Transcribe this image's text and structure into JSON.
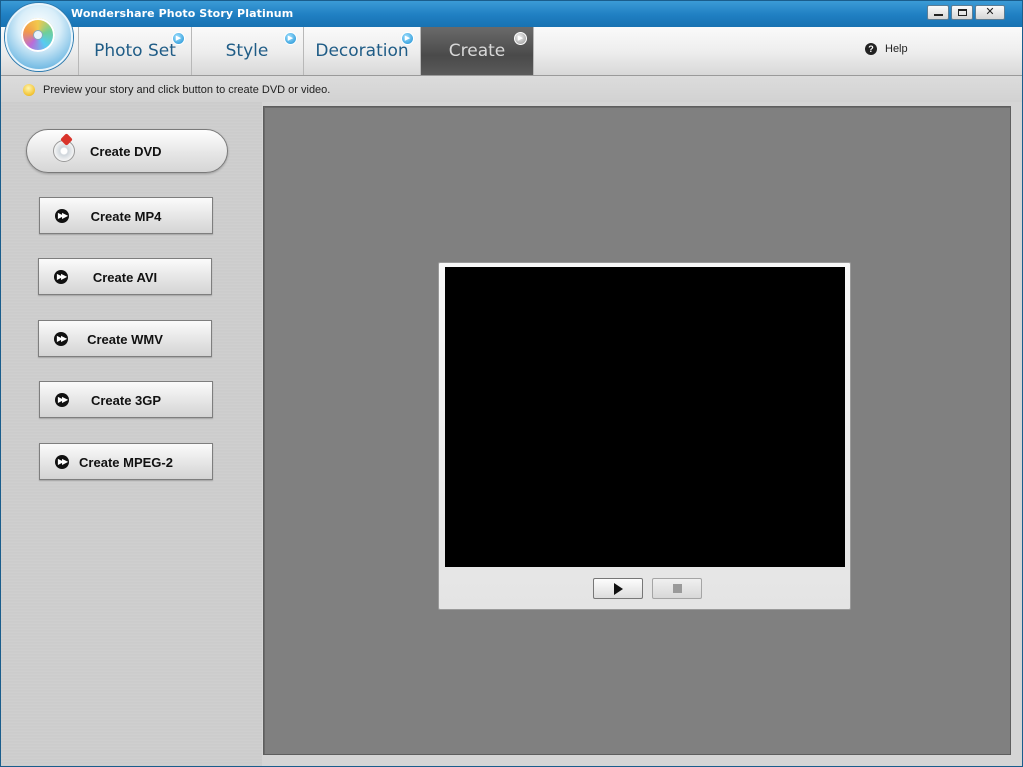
{
  "window": {
    "title": "Wondershare Photo Story Platinum",
    "controls": {
      "minimize": "minimize-icon",
      "maximize": "maximize-icon",
      "close": "close-icon",
      "close_glyph": "✕"
    }
  },
  "tabs": [
    {
      "label": "Photo Set",
      "active": false
    },
    {
      "label": "Style",
      "active": false
    },
    {
      "label": "Decoration",
      "active": false
    },
    {
      "label": "Create",
      "active": true
    }
  ],
  "help": {
    "label": "Help",
    "icon": "help-icon",
    "icon_glyph": "?"
  },
  "hint": {
    "text": "Preview your story and click button to create DVD or video.",
    "icon": "lightbulb-icon"
  },
  "actions": {
    "dvd": {
      "label": "Create DVD",
      "icon": "dvd-disc-icon"
    },
    "formats": [
      {
        "label": "Create MP4",
        "icon": "fast-forward-icon"
      },
      {
        "label": "Create AVI",
        "icon": "fast-forward-icon"
      },
      {
        "label": "Create WMV",
        "icon": "fast-forward-icon"
      },
      {
        "label": "Create 3GP",
        "icon": "fast-forward-icon"
      },
      {
        "label": "Create MPEG-2",
        "icon": "fast-forward-icon"
      }
    ]
  },
  "player": {
    "play": {
      "icon": "play-icon",
      "enabled": true
    },
    "stop": {
      "icon": "stop-icon",
      "enabled": false
    }
  },
  "colors": {
    "titlebar": "#1f7fc2",
    "tab_text": "#1f5c86",
    "active_tab": "#4a4a4a",
    "preview_area": "#808080",
    "screen": "#000000"
  }
}
